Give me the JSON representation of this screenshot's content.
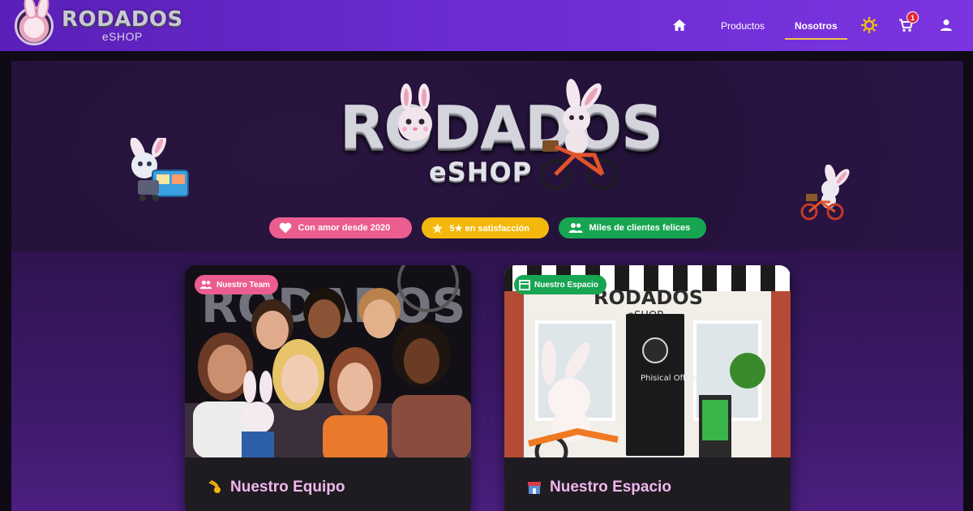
{
  "brand": {
    "name": "RODADOS",
    "sub": "eSHOP"
  },
  "nav": {
    "items": [
      {
        "label": "Productos",
        "active": false
      },
      {
        "label": "Nosotros",
        "active": true
      }
    ],
    "cart_count": "1",
    "icons": [
      "home-icon",
      "sun-icon",
      "cart-icon",
      "user-icon"
    ]
  },
  "hero": {
    "logo_title": "RODADOS",
    "logo_sub": "eSHOP",
    "pills": [
      {
        "label": "Con amor desde 2020",
        "icon": "heart-icon",
        "color": "#ec5d8f"
      },
      {
        "label": "5★ en satisfacción",
        "icon": "star-icon",
        "color": "#f4b80c"
      },
      {
        "label": "Miles de clientes felices",
        "icon": "people-icon",
        "color": "#17a552"
      }
    ]
  },
  "cards": [
    {
      "tag": "Nuestro Team",
      "tag_color": "#ec5d8f",
      "title": "Nuestro Equipo",
      "icon": "comet-icon",
      "image_text": "RODADOS"
    },
    {
      "tag": "Nuestro Espacio",
      "tag_color": "#17a552",
      "title": "Nuestro Espacio",
      "icon": "store-icon",
      "image_text": "RODADOS",
      "image_sub": "eSHOP",
      "door_text": "Phisical Office"
    }
  ],
  "colors": {
    "nav_start": "#5a1fb8",
    "nav_end": "#7b34e0",
    "accent": "#f0c34a",
    "card_title": "#f0b7ee"
  }
}
